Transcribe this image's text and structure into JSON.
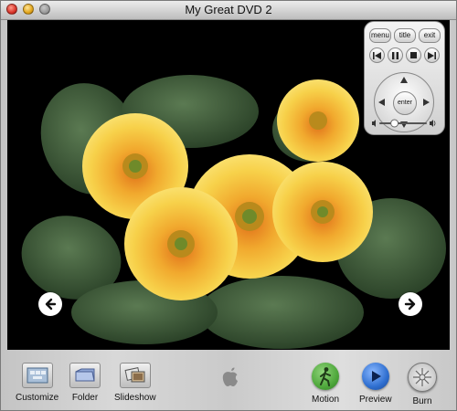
{
  "window": {
    "title": "My Great DVD 2"
  },
  "remote": {
    "menu_label": "menu",
    "title_label": "title",
    "exit_label": "exit",
    "enter_label": "enter",
    "volume_level": 0.32
  },
  "toolbar": {
    "customize_label": "Customize",
    "folder_label": "Folder",
    "slideshow_label": "Slideshow",
    "motion_label": "Motion",
    "preview_label": "Preview",
    "burn_label": "Burn"
  },
  "icons": {
    "left_arrow": "arrow-left-icon",
    "right_arrow": "arrow-right-icon",
    "apple": "apple-logo-icon",
    "motion": "running-man-icon",
    "preview": "play-icon",
    "burn": "burn-disc-icon"
  },
  "colors": {
    "motion_green": "#4fa83c",
    "preview_blue": "#2f6fd0",
    "petal_yellow": "#f4c83a",
    "petal_orange": "#e0701a"
  }
}
